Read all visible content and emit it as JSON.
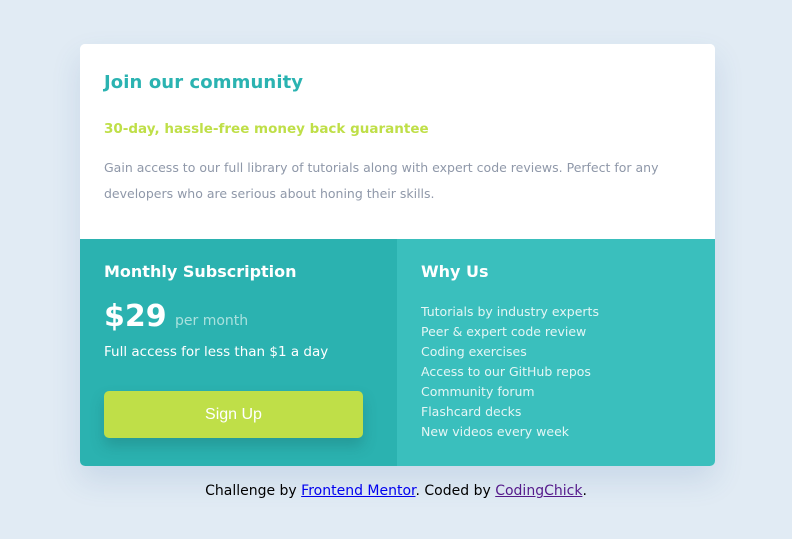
{
  "card": {
    "title": "Join our community",
    "guarantee": "30-day, hassle-free money back guarantee",
    "description": "Gain access to our full library of tutorials along with expert code reviews. Perfect for any developers who are serious about honing their skills."
  },
  "subscription": {
    "title": "Monthly Subscription",
    "price": "$29",
    "period": "per month",
    "access": "Full access for less than $1 a day",
    "button_label": "Sign Up"
  },
  "why_us": {
    "title": "Why Us",
    "items": [
      "Tutorials by industry experts",
      "Peer & expert code review",
      "Coding exercises",
      "Access to our GitHub repos",
      "Community forum",
      "Flashcard decks",
      "New videos every week"
    ]
  },
  "footer": {
    "prefix": "Challenge by ",
    "link1": "Frontend Mentor",
    "middle": ". Coded by ",
    "link2": "CodingChick",
    "suffix": "."
  },
  "colors": {
    "background": "#e1ebf4",
    "accent_cyan": "#2bb3b1",
    "accent_lime": "#bfdf48",
    "why_bg": "#3abfbd"
  }
}
